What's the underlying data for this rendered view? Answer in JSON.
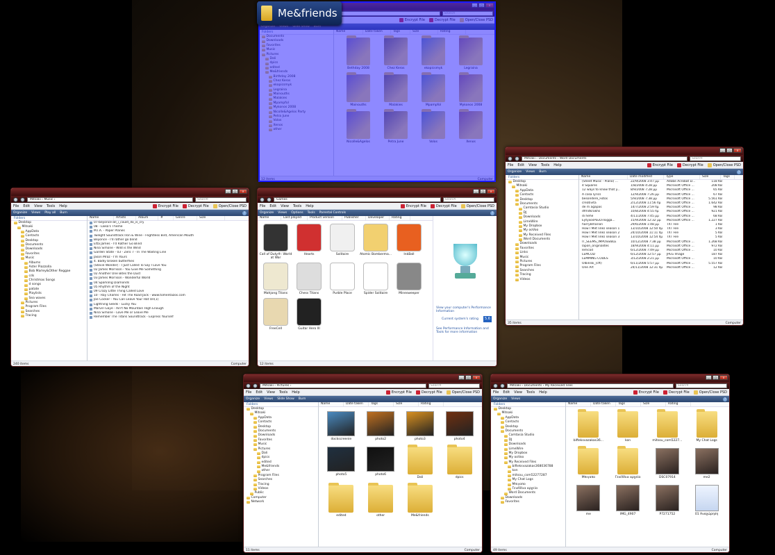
{
  "label_badge": "Me&friends",
  "common": {
    "menu": [
      "File",
      "Edit",
      "View",
      "Tools",
      "Help"
    ],
    "encrypt": "Encrypt File",
    "decrypt": "Decrypt File",
    "openclose": "Open/Close PSD",
    "search": "Search",
    "computer": "Computer",
    "folders": "Folders",
    "organize": "Organize",
    "views": "Views",
    "burn": "Burn",
    "slideshow": "Slide Show"
  },
  "me_window": {
    "path": "Me&friends",
    "nav": [
      "Documents",
      "Downloads",
      "Favorites",
      "Music",
      "Pictures",
      "Dali",
      "dpics",
      "edited",
      "Me&friends",
      "Birthday 2008",
      "Chez Keros",
      "ekopicsmyk",
      "Legraina",
      "Mainouths",
      "Malakies",
      "Mpampfol",
      "Mykonos 2008",
      "Nicolle&Agelos Party",
      "Petra June",
      "Volos",
      "Xenos",
      "other"
    ],
    "cols": [
      "Name",
      "Date taken",
      "Tags",
      "Size",
      "Rating"
    ],
    "items": [
      "Bethday 2008",
      "Chez Keros",
      "ekopicsmyk",
      "Legraina",
      "Mainouths",
      "Malakies",
      "Mpampfol",
      "Mykonos 2008",
      "Nicolle&Agelos",
      "Petra June",
      "Volos",
      "Xenos"
    ],
    "status": "12 items"
  },
  "music_window": {
    "path": "Mitsaki › Music ›",
    "play": "Play all",
    "nav": [
      "Desktop",
      "Mitsaki",
      "AppData",
      "Contacts",
      "Desktop",
      "Documents",
      "Downloads",
      "Favorites",
      "Music",
      "Albums",
      "Aster Piazzolla",
      "Bob Marley&Other Reggae",
      "cds",
      "Christmas Songs",
      "d songs",
      "patate",
      "Playlists",
      "Sea waves",
      "Pictures",
      "Program Files",
      "Searches",
      "Tracing"
    ],
    "cols": [
      "Name",
      "Artists",
      "Album",
      "#",
      "Genre",
      "Size"
    ],
    "tracks": [
      "07-beyonce-all_i_could_do_is_cry",
      "08 - Laika's Theme",
      "M.I.A. - Paper Planes",
      "Twilight Soundtrack Iron & Wine - Flightless Bird, American Mouth",
      "Beyonce - I'd rather go blind",
      "Etta James - I'd Rather Go Blind",
      "Nina Simone - Wild is the Wind",
      "Garden State - 03 - Zero 7 - In The Waiting Line",
      "Jason Mraz - I'm Yours",
      "4. Badly broken butterflies",
      "(Stevie Wonder) - I Just Called To Say I Love You",
      "02 James Morrison - You Give Me Something",
      "02 Another One Bites the Dust",
      "03 James Morrison - Wonderful World",
      "04 Sparkling Diamonds",
      "05 Rhythm of the Night",
      "09 Crazy Little Thing Called Love",
      "10 - Ray Charles - Hit The Road Jack - www.tomentazos.com",
      "Joe Cocker - You Can Leave Your Hat On(1)",
      "Lightning Seeds - Lucky You",
      "Marvin Gaye - Ain't No Mountain High Enough",
      "Nina Simone - Love Me or Leave Me",
      "Remember The Titans Soundtrack - Express Yourself"
    ],
    "status": "240 items"
  },
  "games_window": {
    "path": "Games",
    "options": "Options",
    "tools": "Tools",
    "parental": "Parental Controls",
    "cols": [
      "Name",
      "Last played",
      "Product version",
      "Publisher",
      "Developer",
      "Rating"
    ],
    "games": [
      "Call of Duty®: World at War",
      "Hearts",
      "Solitaire",
      "Atomic Bomberma...",
      "InkBall",
      "Mahjong Titans",
      "Chess Titans",
      "Purble Place",
      "Spider Solitaire",
      "Minesweeper",
      "FreeCell",
      "Guitar Hero III"
    ],
    "perf1": "View your computer's Performance Information",
    "perf2": "Current system's rating",
    "perf3": "See Performance Information and Tools for more information",
    "rating": "5.6",
    "status": "12 items"
  },
  "word_window": {
    "path": "Mitsaki › Documents › Word Documents",
    "nav": [
      "Desktop",
      "Mitsaki",
      "AppData",
      "Contacts",
      "Desktop",
      "Documents",
      "Camtasia Studio",
      "DJ",
      "Downloads",
      "LimeWire",
      "My Dropbox",
      "My ooVoo",
      "My Received Files",
      "Word Documents",
      "Downloads",
      "Favorites",
      "Links",
      "Music",
      "Pictures",
      "Program Files",
      "Searches",
      "Tracing",
      "Videos"
    ],
    "cols": [
      "Name",
      "Date modified",
      "Type",
      "Size",
      "Tags"
    ],
    "rows": [
      [
        "(Sheet Music - Piano) ...",
        "22/9/2008 3:47 µµ",
        "Adobe Acrobat D...",
        "118 KB"
      ],
      [
        "4 Squares",
        "1/8/2008 4:28 µµ",
        "Microsoft Office ...",
        "208 KB"
      ],
      [
        "12 ways to know that y...",
        "8/9/2008 7:28 µµ",
        "Microsoft Office ...",
        "65 KB"
      ],
      [
        "A cosa lyrics",
        "12/9/2008 7:26 µµ",
        "Microsoft Office ...",
        "67 KB"
      ],
      [
        "besondere_Fotos",
        "5/9/2008 7:38 µµ",
        "Microsoft Office ...",
        "5.561 KB"
      ],
      [
        "creativita",
        "2/12/2008 11:56 πµ",
        "Microsoft Office ...",
        "1.642 KB"
      ],
      [
        "de m agapas",
        "14/7/2008 2:59 πµ",
        "Microsoft Office ...",
        "98 KB"
      ],
      [
        "dfmitkrakhs",
        "10/8/2008 4:55 πµ",
        "Microsoft Office ...",
        "921 KB"
      ],
      [
        "di hehe",
        "4/11/2008 7:45 µµ",
        "Microsoft Office ...",
        "68 KB"
      ],
      [
        "EytyxosPouOiTsigga...",
        "15/9/2008 12:32 µµ",
        "Microsoft Office ...",
        "1.227 KB"
      ],
      [
        "harryBmarion",
        "29/6/2008 1:48 µµ",
        "TXT File",
        "1 KB"
      ],
      [
        "How I Met links season 1",
        "13/10/2008 12:50 πµ",
        "TXT File",
        "3 KB"
      ],
      [
        "How I Met links season 2",
        "24/10/2008 11:11 πµ",
        "TXT File",
        "5 KB"
      ],
      [
        "How I Met links season 3",
        "13/10/2008 12:54 πµ",
        "TXT File",
        "5 KB"
      ],
      [
        "IT_SEEMS_IMPOSSIBLE",
        "10/12/2008 7:38 µµ",
        "Microsoft Office ...",
        "1.268 KB"
      ],
      [
        "lapon_originalites",
        "18/9/2008 4:11 µµ",
        "Microsoft Office ...",
        "972 KB"
      ],
      [
        "lemcod",
        "6/12/2008 7:49 µµ",
        "Microsoft Office ...",
        "10 KB"
      ],
      [
        "LEMCOD",
        "6/12/2008 12:57 µµ",
        "JPEG Image",
        "187 KB"
      ],
      [
        "LEMMING CODES",
        "3/12/2008 2:21 µµ",
        "Microsoft Office ...",
        "10 KB"
      ],
      [
        "Olbinski_(cft)",
        "6/11/2008 5:57 µµ",
        "Microsoft Office ...",
        "5.557 KB"
      ],
      [
        "One Art",
        "24/11/2008 12:31 πµ",
        "Microsoft Office ...",
        "12 KB"
      ]
    ],
    "status": "35 items"
  },
  "pictures_window": {
    "path": "Mitsaki › Pictures ›",
    "nav": [
      "Desktop",
      "Mitsaki",
      "AppData",
      "Contacts",
      "Desktop",
      "Documents",
      "Downloads",
      "Favorites",
      "Music",
      "Pictures",
      "Dali",
      "dpics",
      "edited",
      "Me&friends",
      "other",
      "Program Files",
      "Searches",
      "Tracing",
      "Videos",
      "Public",
      "Computer",
      "Network"
    ],
    "cols": [
      "Name",
      "Date taken",
      "Tags",
      "Size",
      "Rating"
    ],
    "items": [
      "dockscreenie",
      "photo2",
      "photo3",
      "photo4",
      "photo5",
      "photo6",
      "Dali",
      "dpics",
      "edited",
      "other",
      "Me&friends"
    ],
    "status": "11 items"
  },
  "received_window": {
    "path": "Mitsaki › Documents › My Received Files",
    "nav": [
      "Desktop",
      "Mitsaki",
      "AppData",
      "Contacts",
      "Desktop",
      "Documents",
      "Camtasia Studio",
      "DJ",
      "Downloads",
      "LimeWire",
      "My Dropbox",
      "My ooVoo",
      "My Received Files",
      "bifteksvazakas368036788",
      "kon",
      "mitsou_com52277287",
      "My Chat Logs",
      "Μπιγαπο",
      "Γενέθλια αρχεία",
      "Word Documents",
      "Downloads",
      "Favorites"
    ],
    "cols": [
      "Name",
      "Date taken",
      "Tags",
      "Size",
      "Rating"
    ],
    "items": [
      "bifteksvazakas36...",
      "kon",
      "mitsou_com5227...",
      "My Chat Logs",
      "Μπιγαπο",
      "Γενέθλια αρχεία",
      "DSC07914",
      "me2",
      "me",
      "IMG_4907",
      "P7271752",
      "01 Αναχώρηση"
    ],
    "status": "49 items"
  },
  "colors": {
    "folder": "#e9c455",
    "title": "#5a1c1c",
    "toolbar": "#2b4670",
    "overlay": "#3228ff"
  }
}
